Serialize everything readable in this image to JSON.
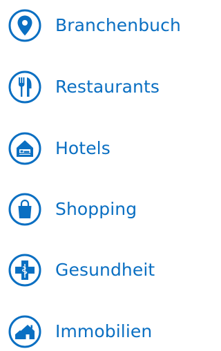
{
  "colors": {
    "brand_blue": "#0a6fc2",
    "icon_blue": "#0a6fc2",
    "background": "#ffffff"
  },
  "menu": {
    "items": [
      {
        "id": "branchenbuch",
        "label": "Branchenbuch",
        "icon": "map-pin-icon"
      },
      {
        "id": "restaurants",
        "label": "Restaurants",
        "icon": "fork-knife-icon"
      },
      {
        "id": "hotels",
        "label": "Hotels",
        "icon": "hotel-bed-icon"
      },
      {
        "id": "shopping",
        "label": "Shopping",
        "icon": "shopping-bag-icon"
      },
      {
        "id": "gesundheit",
        "label": "Gesundheit",
        "icon": "medical-cross-icon"
      },
      {
        "id": "immobilien",
        "label": "Immobilien",
        "icon": "house-icon"
      }
    ]
  }
}
